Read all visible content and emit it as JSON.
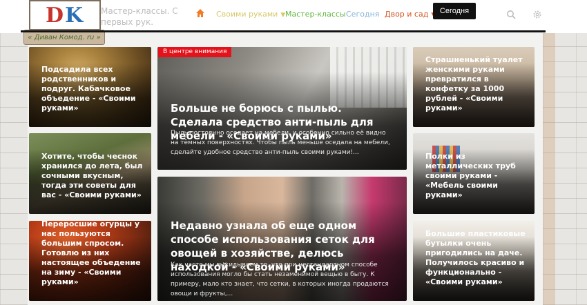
{
  "site": {
    "logo_letters": [
      "D",
      "K"
    ],
    "logo_plate": "« Диван Комод. ru »",
    "tagline": "Мастер-классы. С первых рук."
  },
  "nav": {
    "items": [
      {
        "label": "Своими руками",
        "has_dropdown": true,
        "color": "#d7c96a"
      },
      {
        "label": "Мастер-классы",
        "has_dropdown": false,
        "color": "#5fb83e"
      },
      {
        "label": "Сегодня",
        "has_dropdown": false,
        "color": "#86b2d9"
      },
      {
        "label": "Двор и сад",
        "has_dropdown": true,
        "color": "#d3511e"
      }
    ],
    "today_button": "Сегодня",
    "accent_home": "#f07c27"
  },
  "featured": {
    "badge": "В центре внимания",
    "main": {
      "title": "Больше не борюсь с пылью. Сделала средство анти-пыль для мебели - «Своими руками»",
      "excerpt": "Пыль постоянно оседает на мебели, и особенно сильно её видно на тёмных поверхностях. Чтобы пыль меньше оседала на мебели, сделайте удобное средство анти-пыль своими руками!..."
    },
    "second": {
      "title": "Недавно узнала об еще одном способе использования сеток для овощей в хозяйстве, делюсь находкой - «Своими руками»",
      "excerpt": "Как часто мы выкидываем то, что при нестандартном способе использования могло бы стать незаменимой вещью в быту. К примеру, мало кто знает, что сетки, в которых иногда продаются овощи и фрукты,..."
    }
  },
  "left_cards": [
    {
      "title": "Подсадила всех родственников и подруг. Кабачковое объедение - «Своими руками»"
    },
    {
      "title": "Хотите, чтобы чеснок хранился до лета, был сочными вкусным, тогда эти советы для вас - «Своими руками»"
    },
    {
      "title": "Переросшие огурцы у нас пользуются большим спросом. Готовлю из них настоящее объедение на зиму - «Своими руками»"
    }
  ],
  "right_cards": [
    {
      "title": "Страшненький туалет женскими руками превратился в конфетку за 1000 рублей - «Своими руками»"
    },
    {
      "title": "Полки из металлических труб своими руками - «Мебель своими руками»"
    },
    {
      "title": "Большие пластиковые бутылки очень пригодились на даче. Получилось красиво и функционально - «Своими руками»"
    }
  ]
}
